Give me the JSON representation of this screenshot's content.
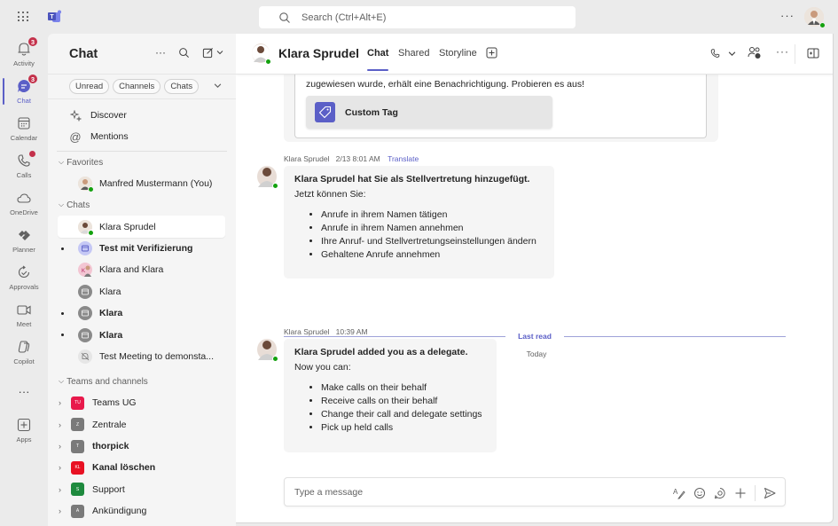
{
  "titlebar": {
    "search_placeholder": "Search (Ctrl+Alt+E)",
    "more_label": "···"
  },
  "rail": {
    "items": [
      {
        "label": "Activity",
        "badge": "3"
      },
      {
        "label": "Chat",
        "badge": "3"
      },
      {
        "label": "Calendar"
      },
      {
        "label": "Calls"
      },
      {
        "label": "OneDrive"
      },
      {
        "label": "Planner"
      },
      {
        "label": "Approvals"
      },
      {
        "label": "Meet"
      },
      {
        "label": "Copilot"
      },
      {
        "label": "···"
      },
      {
        "label": "Apps"
      }
    ]
  },
  "sidebar": {
    "title": "Chat",
    "filters": [
      "Unread",
      "Channels",
      "Chats"
    ],
    "nav": [
      {
        "label": "Discover"
      },
      {
        "label": "Mentions"
      }
    ],
    "favorites_label": "Favorites",
    "favorites": [
      {
        "name": "Manfred Mustermann (You)"
      }
    ],
    "chats_label": "Chats",
    "chats": [
      {
        "name": "Klara Sprudel",
        "unread": false,
        "selected": true
      },
      {
        "name": "Test mit Verifizierung",
        "unread": true
      },
      {
        "name": "Klara and Klara",
        "unread": false
      },
      {
        "name": "Klara",
        "unread": false
      },
      {
        "name": "Klara",
        "unread": true
      },
      {
        "name": "Klara",
        "unread": true
      },
      {
        "name": "Test Meeting to demonsta...",
        "unread": false
      }
    ],
    "teams_label": "Teams and channels",
    "teams": [
      {
        "name": "Teams UG",
        "initials": "TU",
        "color": "#e8194b",
        "bold": false
      },
      {
        "name": "Zentrale",
        "initials": "Z",
        "color": "#7a7a7a",
        "bold": false
      },
      {
        "name": "thorpick",
        "initials": "T",
        "color": "#7a7a7a",
        "bold": true
      },
      {
        "name": "Kanal löschen",
        "initials": "KL",
        "color": "#e81123",
        "bold": true
      },
      {
        "name": "Support",
        "initials": "S",
        "color": "#1e8a3e",
        "bold": false
      },
      {
        "name": "Ankündigung",
        "initials": "A",
        "color": "#7a7a7a",
        "bold": false
      }
    ]
  },
  "main": {
    "contact_name": "Klara Sprudel",
    "tabs": [
      "Chat",
      "Shared",
      "Storyline"
    ],
    "card": {
      "text": "zugewiesen wurde, erhält eine Benachrichtigung. Probieren es aus!",
      "button_label": "Custom Tag"
    },
    "messages": [
      {
        "sender": "Klara Sprudel",
        "time": "2/13 8:01 AM",
        "translate": "Translate",
        "title": "Klara Sprudel hat Sie als Stellvertretung hinzugefügt.",
        "intro": "Jetzt können Sie:",
        "items": [
          "Anrufe in ihrem Namen tätigen",
          "Anrufe in ihrem Namen annehmen",
          "Ihre Anruf- und Stellvertretungseinstellungen ändern",
          "Gehaltene Anrufe annehmen"
        ]
      },
      {
        "sender": "Klara Sprudel",
        "time": "10:39 AM",
        "title": "Klara Sprudel added you as a delegate.",
        "intro": "Now you can:",
        "items": [
          "Make calls on their behalf",
          "Receive calls on their behalf",
          "Change their call and delegate settings",
          "Pick up held calls"
        ]
      }
    ],
    "last_read_label": "Last read",
    "day_label": "Today",
    "compose_placeholder": "Type a message"
  },
  "colors": {
    "accent": "#5b5fc7",
    "badge": "#c4314b",
    "presence": "#13a10e"
  }
}
